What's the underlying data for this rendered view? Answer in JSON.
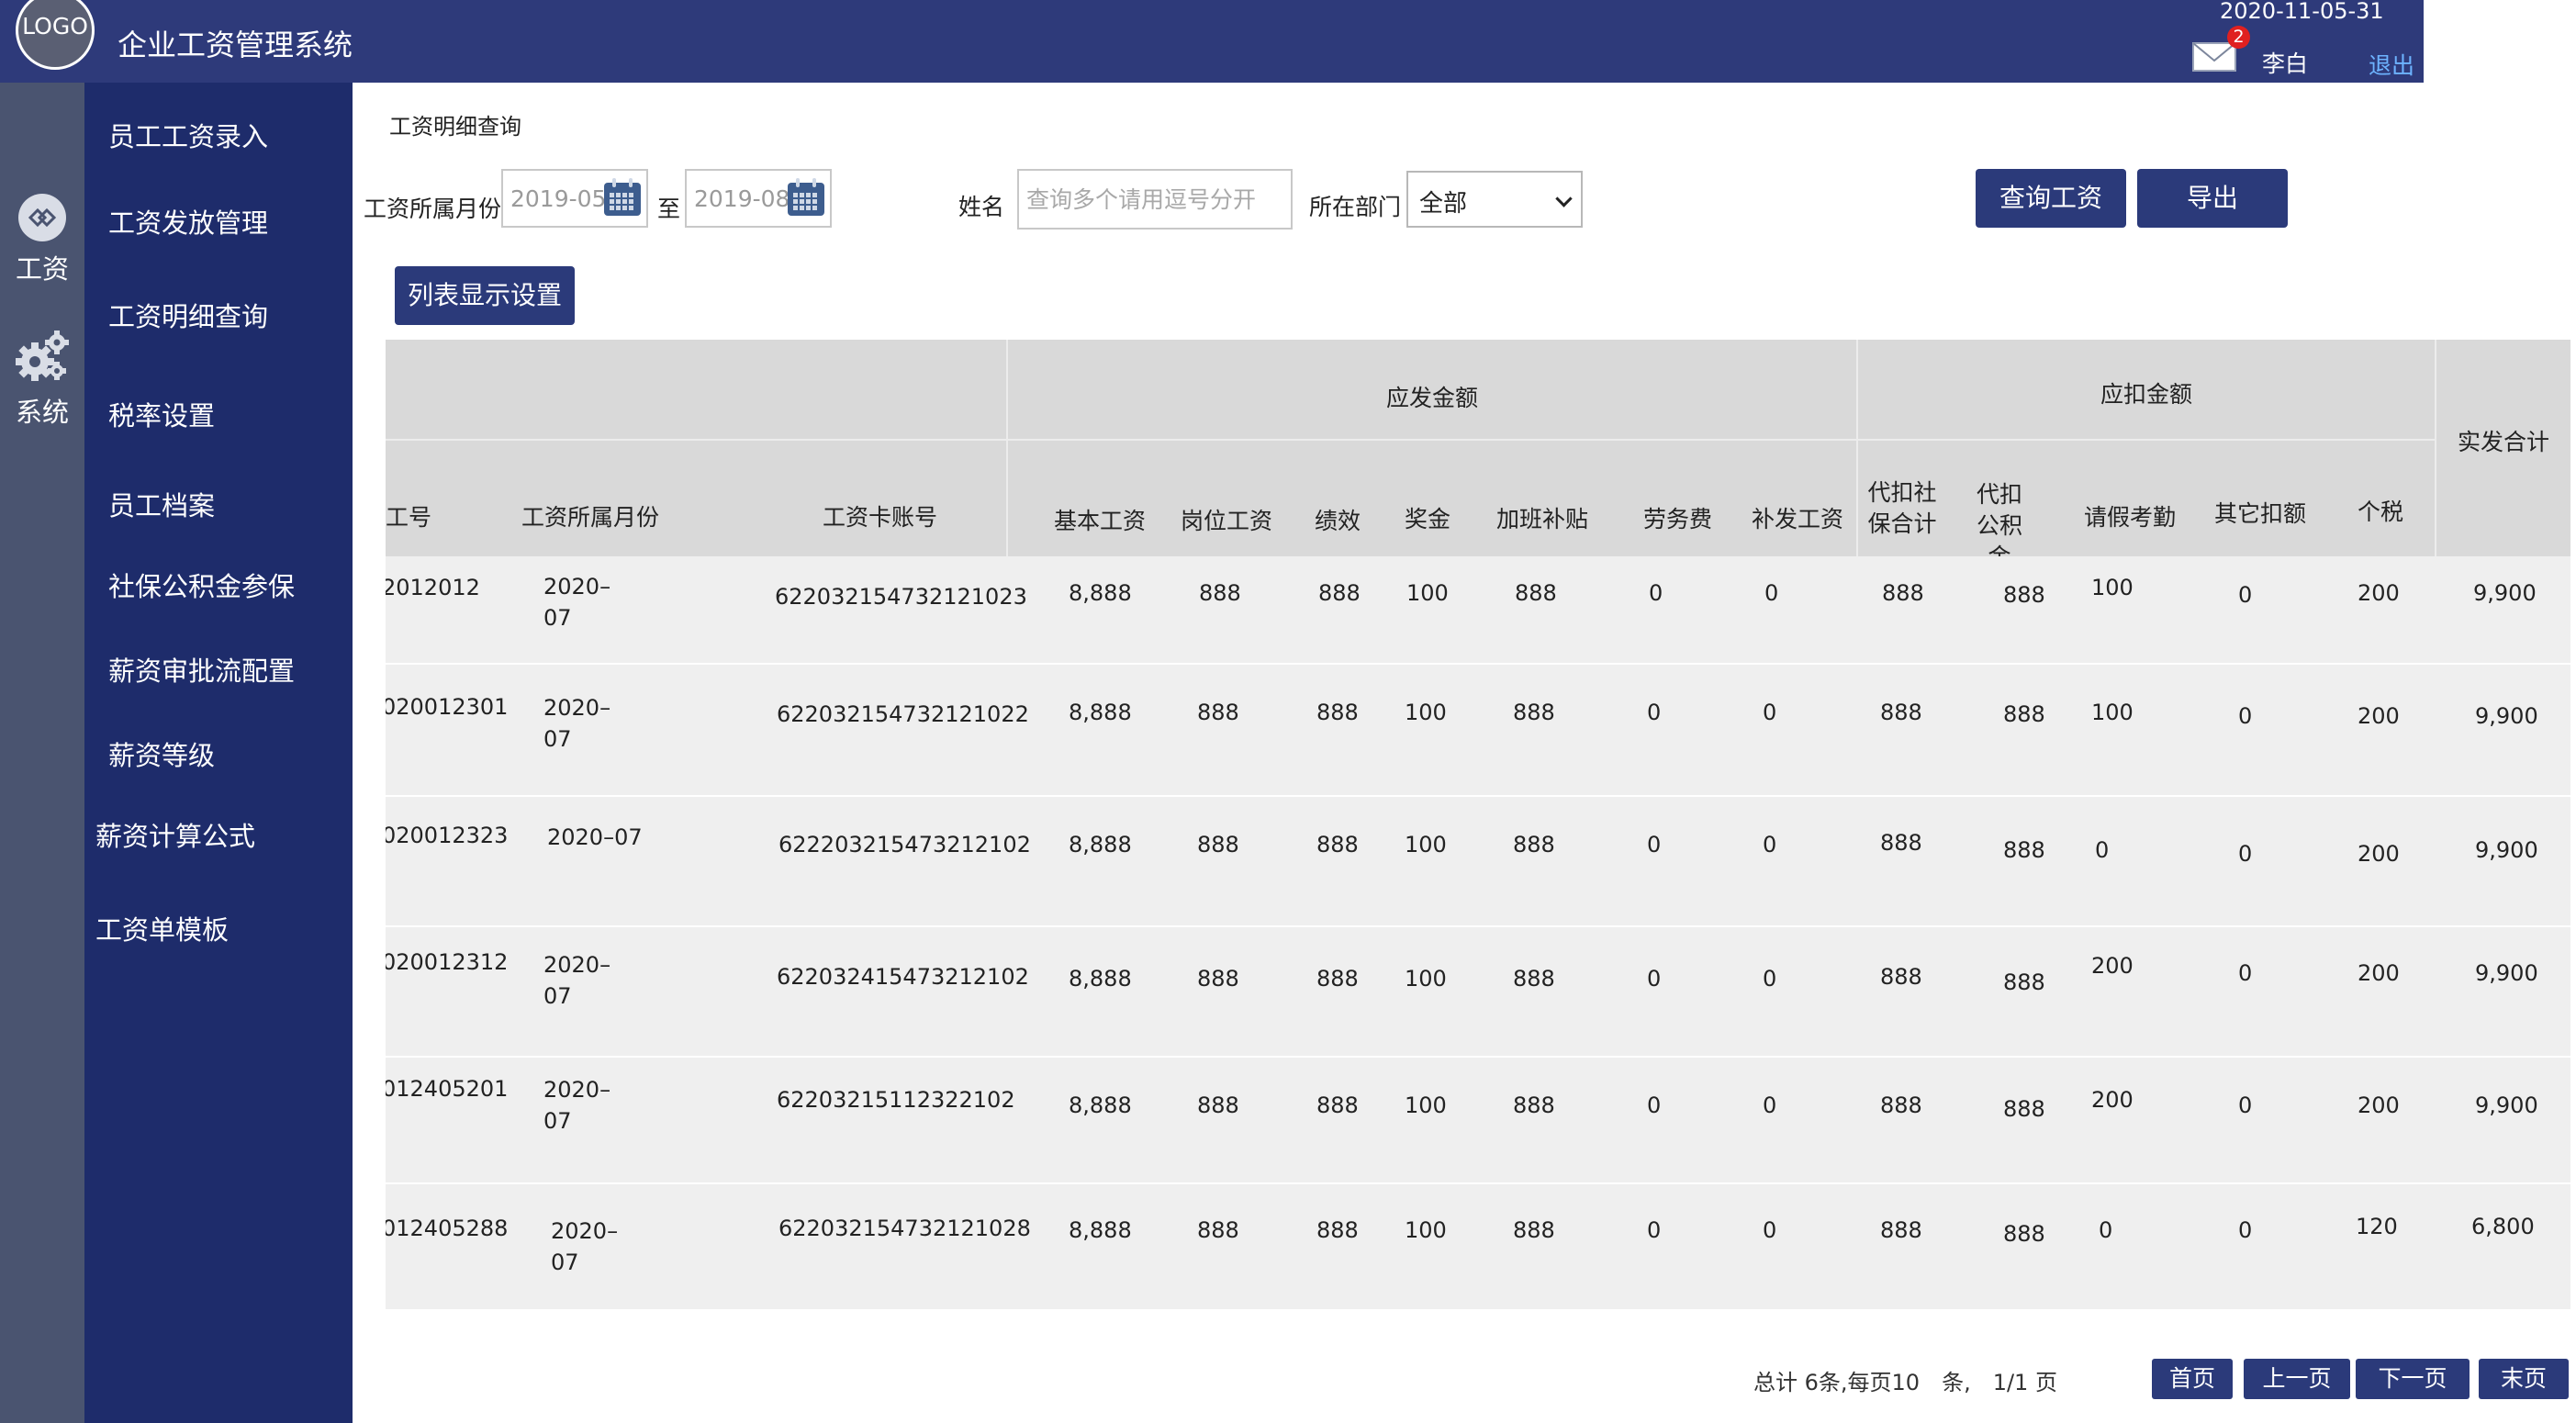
{
  "header": {
    "logo_text": "LOGO",
    "app_title": "企业工资管理系统",
    "date": "2020-11-05-31",
    "message_count": "2",
    "user_name": "李白",
    "logout_label": "退出",
    "mail_icon": "mail-icon"
  },
  "sidebar": {
    "categories": [
      {
        "label": "工资",
        "icon": "salary-icon"
      },
      {
        "label": "系统",
        "icon": "gear-icon"
      }
    ],
    "items": [
      {
        "label": "员工工资录入"
      },
      {
        "label": "工资发放管理"
      },
      {
        "label": "工资明细查询"
      },
      {
        "label": "税率设置"
      },
      {
        "label": "员工档案"
      },
      {
        "label": "社保公积金参保"
      },
      {
        "label": "薪资审批流配置"
      },
      {
        "label": "薪资等级"
      },
      {
        "label": "薪资计算公式"
      },
      {
        "label": "工资单模板"
      }
    ]
  },
  "page": {
    "heading": "工资明细查询"
  },
  "filters": {
    "month_label": "工资所属月份",
    "start_month": "2019-05",
    "to_label": "至",
    "end_month": "2019-08",
    "name_label": "姓名",
    "name_placeholder": "查询多个请用逗号分开",
    "dept_label": "所在部门",
    "dept_value": "全部",
    "query_button": "查询工资",
    "export_button": "导出",
    "list_settings_button": "列表显示设置",
    "calendar_icon": "calendar-icon"
  },
  "table": {
    "group_headers": {
      "payable": "应发金额",
      "deduction": "应扣金额",
      "net_total": "实发合计"
    },
    "columns": {
      "emp_no": "工号",
      "month": "工资所属月份",
      "card": "工资卡账号",
      "base": "基本工资",
      "post": "岗位工资",
      "perf": "绩效",
      "bonus": "奖金",
      "overtime": "加班补贴",
      "labor": "劳务费",
      "back_pay": "补发工资",
      "social": "代扣社保合计",
      "fund": "代扣公积金",
      "leave": "请假考勤",
      "other": "其它扣额",
      "tax": "个税"
    },
    "rows": [
      {
        "emp_no": "2012012",
        "month": "2020–07",
        "card": "622032154732121023",
        "base": "8,888",
        "post": "888",
        "perf": "888",
        "bonus": "100",
        "overtime": "888",
        "labor": "0",
        "back_pay": "0",
        "social": "888",
        "fund": "888",
        "leave": "100",
        "other": "0",
        "tax": "200",
        "net": "9,900"
      },
      {
        "emp_no": "020012301",
        "month": "2020–07",
        "card": "622032154732121022",
        "base": "8,888",
        "post": "888",
        "perf": "888",
        "bonus": "100",
        "overtime": "888",
        "labor": "0",
        "back_pay": "0",
        "social": "888",
        "fund": "888",
        "leave": "100",
        "other": "0",
        "tax": "200",
        "net": "9,900"
      },
      {
        "emp_no": "020012323",
        "month": "2020–07",
        "card": "622203215473212102",
        "base": "8,888",
        "post": "888",
        "perf": "888",
        "bonus": "100",
        "overtime": "888",
        "labor": "0",
        "back_pay": "0",
        "social": "888",
        "fund": "888",
        "leave": "0",
        "other": "0",
        "tax": "200",
        "net": "9,900"
      },
      {
        "emp_no": "020012312",
        "month": "2020–07",
        "card": "622032415473212102",
        "base": "8,888",
        "post": "888",
        "perf": "888",
        "bonus": "100",
        "overtime": "888",
        "labor": "0",
        "back_pay": "0",
        "social": "888",
        "fund": "888",
        "leave": "200",
        "other": "0",
        "tax": "200",
        "net": "9,900"
      },
      {
        "emp_no": "012405201",
        "month": "2020–07",
        "card": "62203215112322102",
        "base": "8,888",
        "post": "888",
        "perf": "888",
        "bonus": "100",
        "overtime": "888",
        "labor": "0",
        "back_pay": "0",
        "social": "888",
        "fund": "888",
        "leave": "200",
        "other": "0",
        "tax": "200",
        "net": "9,900"
      },
      {
        "emp_no": "012405288",
        "month": "2020–07",
        "card": "622032154732121028",
        "base": "8,888",
        "post": "888",
        "perf": "888",
        "bonus": "100",
        "overtime": "888",
        "labor": "0",
        "back_pay": "0",
        "social": "888",
        "fund": "888",
        "leave": "0",
        "other": "0",
        "tax": "120",
        "net": "6,800"
      }
    ]
  },
  "pager": {
    "info": "总计 6条,每页10　条,　1/1 页",
    "first": "首页",
    "prev": "上一页",
    "next": "下一页",
    "last": "末页"
  },
  "colors": {
    "header_bg": "#2e3a7a",
    "menu_bg": "#1e2c6b",
    "strip_bg": "#4a5470",
    "button_bg": "#2b3a7a",
    "table_header_bg": "#d9d9d9",
    "table_body_bg": "#efefef",
    "logout_link": "#6db3ff"
  }
}
